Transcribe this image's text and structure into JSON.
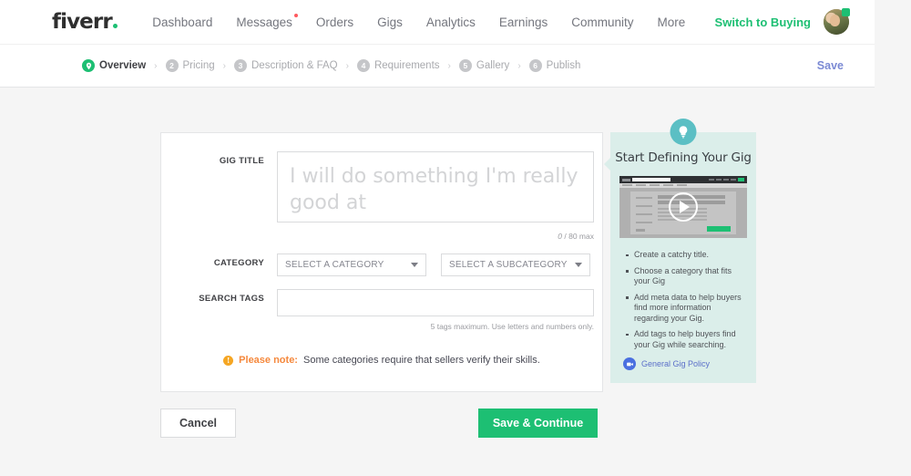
{
  "header": {
    "logo_text": "fiverr",
    "nav_items": [
      {
        "label": "Dashboard",
        "badge": false
      },
      {
        "label": "Messages",
        "badge": true
      },
      {
        "label": "Orders",
        "badge": false
      },
      {
        "label": "Gigs",
        "badge": false
      },
      {
        "label": "Analytics",
        "badge": false
      },
      {
        "label": "Earnings",
        "badge": false
      },
      {
        "label": "Community",
        "badge": false
      },
      {
        "label": "More",
        "badge": false
      }
    ],
    "switch_label": "Switch to Buying",
    "avatar_name": "user-avatar",
    "accent_green": "#1dbf73",
    "badge_red": "#ff5a5f"
  },
  "steps_bar": {
    "steps": [
      {
        "num": "1",
        "label": "Overview",
        "active": true
      },
      {
        "num": "2",
        "label": "Pricing",
        "active": false
      },
      {
        "num": "3",
        "label": "Description & FAQ",
        "active": false
      },
      {
        "num": "4",
        "label": "Requirements",
        "active": false
      },
      {
        "num": "5",
        "label": "Gallery",
        "active": false
      },
      {
        "num": "6",
        "label": "Publish",
        "active": false
      }
    ],
    "separator": "›",
    "save_label": "Save",
    "save_color": "#7b8ad4"
  },
  "form": {
    "title_label": "GIG TITLE",
    "title_value": "",
    "title_placeholder": "I will do something I'm really good at",
    "counter_current": "0",
    "counter_suffix": "/ 80 max",
    "category_label": "CATEGORY",
    "category_placeholder": "SELECT A CATEGORY",
    "subcategory_placeholder": "SELECT A SUBCATEGORY",
    "tags_label": "SEARCH TAGS",
    "tags_value": "",
    "tags_hint": "5 tags maximum. Use letters and numbers only.",
    "note_icon_char": "!",
    "note_strong": "Please note:",
    "note_text": "Some categories require that sellers verify their skills.",
    "note_accent": "#f5883c"
  },
  "sidebar": {
    "icon_name": "lightbulb-icon",
    "title": "Start Defining Your Gig",
    "video_alt": "gig-tutorial-video",
    "bullets": [
      "Create a catchy title.",
      "Choose a category that fits your Gig",
      "Add meta data to help buyers find more information regarding your Gig.",
      "Add tags to help buyers find your Gig while searching."
    ],
    "policy_label": "General Gig Policy",
    "panel_color": "#dbeeea",
    "badge_color": "#5bbfc4",
    "policy_color": "#5b6fc9"
  },
  "actions": {
    "cancel_label": "Cancel",
    "save_continue_label": "Save & Continue",
    "save_bg": "#1dbf73"
  }
}
